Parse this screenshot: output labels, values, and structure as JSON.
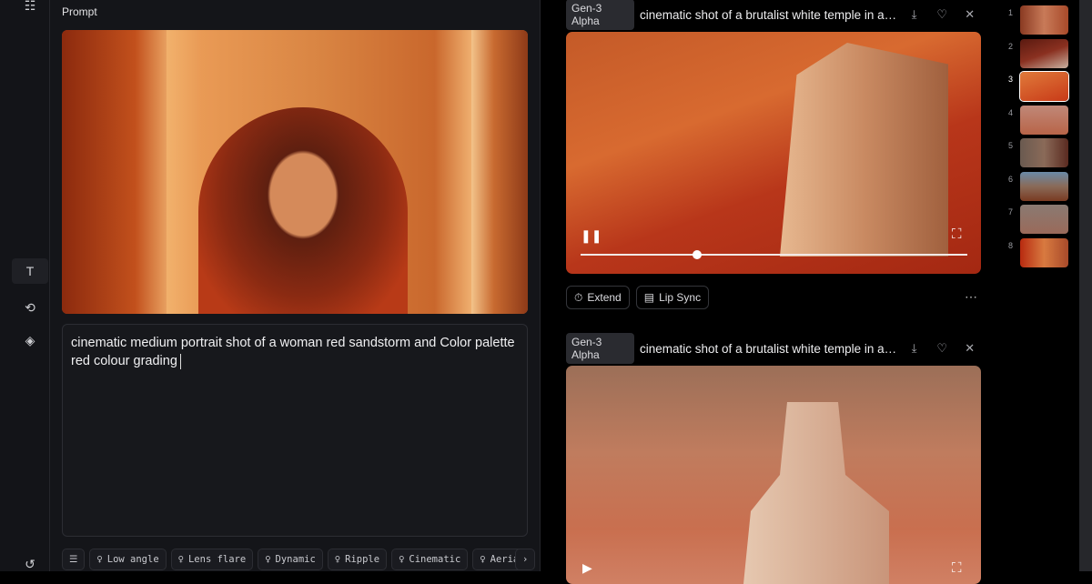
{
  "rail": {
    "icons": [
      "list-icon",
      "text-icon",
      "camera-move-icon",
      "layers-icon",
      "history-icon"
    ]
  },
  "panel": {
    "title": "Prompt",
    "prompt_text": "cinematic medium portrait shot of a woman red sandstorm and Color palette red colour grading",
    "chips": [
      "Low angle",
      "Lens flare",
      "Dynamic",
      "Ripple",
      "Cinematic",
      "Aerial"
    ]
  },
  "generations": [
    {
      "model": "Gen-3 Alpha",
      "title": "cinematic shot of a brutalist white temple in a des...",
      "progress": 0.3,
      "actions": [
        "Extend",
        "Lip Sync"
      ]
    },
    {
      "model": "Gen-3 Alpha",
      "title": "cinematic shot of a brutalist white temple in a des..."
    }
  ],
  "thumbnails": [
    {
      "n": "1"
    },
    {
      "n": "2"
    },
    {
      "n": "3",
      "active": true
    },
    {
      "n": "4"
    },
    {
      "n": "5"
    },
    {
      "n": "6"
    },
    {
      "n": "7"
    },
    {
      "n": "8"
    }
  ]
}
